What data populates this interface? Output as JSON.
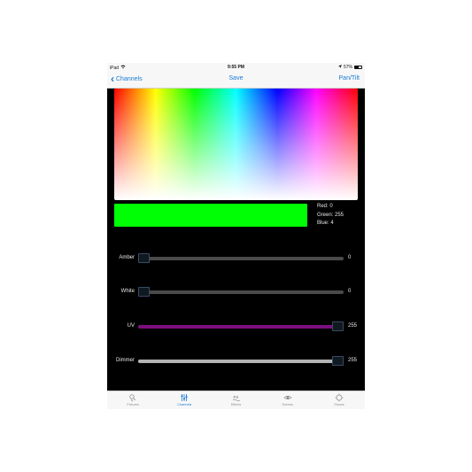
{
  "status": {
    "carrier": "iPad",
    "time": "9:55 PM",
    "battery": "57%",
    "battery_level": 0.57
  },
  "nav": {
    "back_label": "Channels",
    "title": "Save",
    "right_label": "Pan/Tilt"
  },
  "selected_color": {
    "hex": "#00ff04",
    "red_label": "Red: 0",
    "green_label": "Green: 255",
    "blue_label": "Blue: 4"
  },
  "sliders": [
    {
      "label": "Amber",
      "value": "0",
      "level": 0,
      "fill": "#4a4a4a"
    },
    {
      "label": "White",
      "value": "0",
      "level": 0,
      "fill": "#4a4a4a"
    },
    {
      "label": "UV",
      "value": "255",
      "level": 1,
      "fill": "#7b0f7e"
    },
    {
      "label": "Dimmer",
      "value": "255",
      "level": 1,
      "fill": "#b3b3b3"
    }
  ],
  "tabs": [
    {
      "label": "Fixtures",
      "icon": "fixtures-icon",
      "active": false
    },
    {
      "label": "Channels",
      "icon": "channels-icon",
      "active": true
    },
    {
      "label": "Effects",
      "icon": "effects-icon",
      "active": false
    },
    {
      "label": "Scenes",
      "icon": "scenes-icon",
      "active": false
    },
    {
      "label": "Shows",
      "icon": "shows-icon",
      "active": false
    }
  ],
  "colors": {
    "accent": "#1a7bd6",
    "inactive_tab": "#8e8e8e"
  }
}
